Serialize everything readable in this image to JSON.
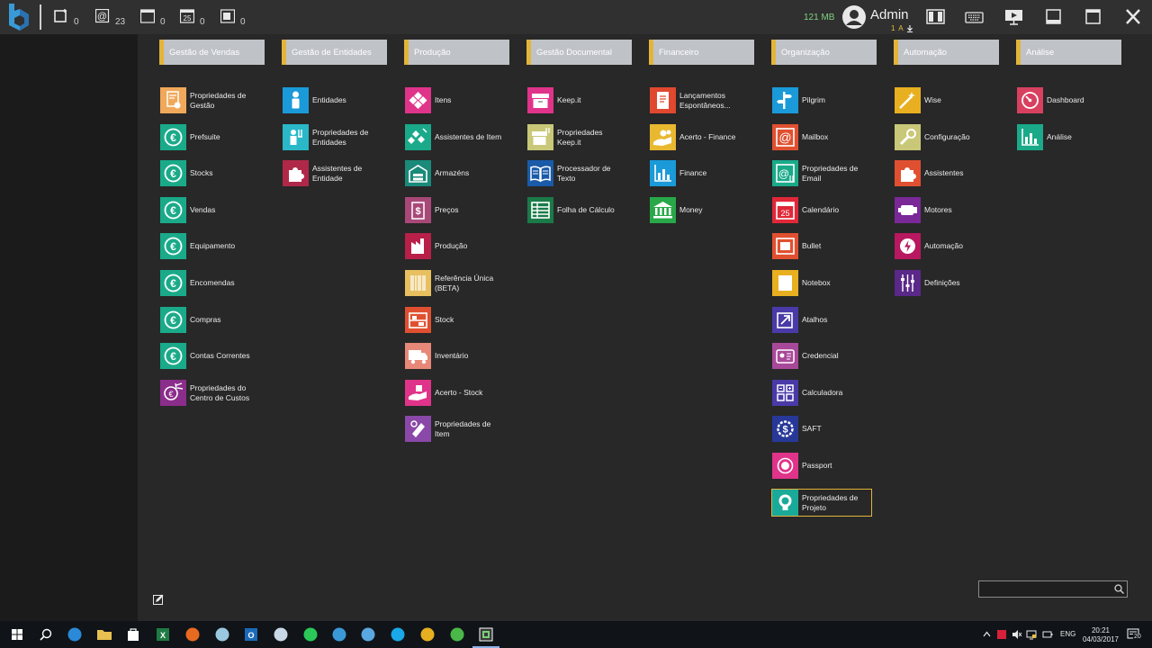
{
  "topbar": {
    "counters": [
      {
        "icon": "new-window-icon",
        "count": "0"
      },
      {
        "icon": "at-sign-icon",
        "count": "23"
      },
      {
        "icon": "window-icon",
        "count": "0"
      },
      {
        "icon": "calendar-25-icon",
        "count": "0"
      },
      {
        "icon": "notes-window-icon",
        "count": "0"
      }
    ],
    "memory": "121 MB",
    "user_name": "Admin",
    "user_sub": "1 A",
    "right_icons": [
      "layout-panels-icon",
      "keyboard-icon",
      "present-screen-icon",
      "minimize-icon",
      "maximize-icon",
      "close-icon"
    ]
  },
  "columns": [
    {
      "title": "Gestão de Vendas",
      "items": [
        {
          "label": "Propriedades de Gestão",
          "color": "#f0a85a",
          "icon": "document-settings-icon"
        },
        {
          "label": "Prefsuite",
          "color": "#1aaa8a",
          "icon": "euro-icon"
        },
        {
          "label": "Stocks",
          "color": "#1aaa8a",
          "icon": "euro-icon"
        },
        {
          "label": "Vendas",
          "color": "#1aaa8a",
          "icon": "euro-icon"
        },
        {
          "label": "Equipamento",
          "color": "#1aaa8a",
          "icon": "euro-icon"
        },
        {
          "label": "Encomendas",
          "color": "#1aaa8a",
          "icon": "euro-icon"
        },
        {
          "label": "Compras",
          "color": "#1aaa8a",
          "icon": "euro-icon"
        },
        {
          "label": "Contas Correntes",
          "color": "#1aaa8a",
          "icon": "euro-icon"
        },
        {
          "label": "Propriedades do Centro de Custos",
          "color": "#8b2d8b",
          "icon": "euro-settings-icon"
        }
      ]
    },
    {
      "title": "Gestão de Entidades",
      "items": [
        {
          "label": "Entidades",
          "color": "#1a9ad8",
          "icon": "person-icon"
        },
        {
          "label": "Propriedades de Entidades",
          "color": "#2ab8c8",
          "icon": "person-settings-icon"
        },
        {
          "label": "Assistentes de Entidade",
          "color": "#b02848",
          "icon": "puzzle-icon"
        }
      ]
    },
    {
      "title": "Produção",
      "items": [
        {
          "label": "Itens",
          "color": "#e0338a",
          "icon": "diamonds-icon"
        },
        {
          "label": "Assistentes de Item",
          "color": "#1aaa8a",
          "icon": "diamonds-wizard-icon"
        },
        {
          "label": "Armazéns",
          "color": "#1a8a7a",
          "icon": "warehouse-icon"
        },
        {
          "label": "Preços",
          "color": "#a84878",
          "icon": "price-tag-icon"
        },
        {
          "label": "Produção",
          "color": "#b8204a",
          "icon": "factory-icon"
        },
        {
          "label": "Referência Única (BETA)",
          "color": "#e8c060",
          "icon": "barcode-icon"
        },
        {
          "label": "Stock",
          "color": "#e05030",
          "icon": "shelf-icon"
        },
        {
          "label": "Inventário",
          "color": "#e88878",
          "icon": "truck-icon"
        },
        {
          "label": "Acerto - Stock",
          "color": "#e0338a",
          "icon": "hand-adjust-icon"
        },
        {
          "label": "Propriedades de Item",
          "color": "#8a48a8",
          "icon": "item-settings-icon"
        }
      ]
    },
    {
      "title": "Gestão Documental",
      "items": [
        {
          "label": "Keep.it",
          "color": "#e0338a",
          "icon": "archive-box-icon"
        },
        {
          "label": "Propriedades Keep.it",
          "color": "#c8c878",
          "icon": "archive-settings-icon"
        },
        {
          "label": "Processador de Texto",
          "color": "#1a5aa8",
          "icon": "open-book-icon"
        },
        {
          "label": "Folha de Cálculo",
          "color": "#1a7a48",
          "icon": "spreadsheet-icon"
        }
      ]
    },
    {
      "title": "Financeiro",
      "items": [
        {
          "label": "Lançamentos Espontâneos...",
          "color": "#e04830",
          "icon": "ledger-icon"
        },
        {
          "label": "Acerto - Finance",
          "color": "#e8b830",
          "icon": "hand-coins-icon"
        },
        {
          "label": "Finance",
          "color": "#1a9ad8",
          "icon": "bar-chart-icon"
        },
        {
          "label": "Money",
          "color": "#28a848",
          "icon": "bank-icon"
        }
      ]
    },
    {
      "title": "Organização",
      "items": [
        {
          "label": "Pilgrim",
          "color": "#1a9ad8",
          "icon": "signpost-icon"
        },
        {
          "label": "Mailbox",
          "color": "#e05030",
          "icon": "at-sign-icon"
        },
        {
          "label": "Propriedades de Email",
          "color": "#1aaa8a",
          "icon": "email-settings-icon"
        },
        {
          "label": "Calendário",
          "color": "#e02838",
          "icon": "calendar-25-icon"
        },
        {
          "label": "Bullet",
          "color": "#e05030",
          "icon": "bullet-icon"
        },
        {
          "label": "Notebox",
          "color": "#e8b020",
          "icon": "note-icon"
        },
        {
          "label": "Atalhos",
          "color": "#4a3aa8",
          "icon": "shortcut-icon"
        },
        {
          "label": "Credencial",
          "color": "#a84898",
          "icon": "id-card-icon"
        },
        {
          "label": "Calculadora",
          "color": "#4a3aa8",
          "icon": "calculator-icon"
        },
        {
          "label": "SAFT",
          "color": "#283898",
          "icon": "gear-dollar-icon"
        },
        {
          "label": "Passport",
          "color": "#e0338a",
          "icon": "passport-icon"
        },
        {
          "label": "Propriedades de Projeto",
          "color": "#1aaa9a",
          "icon": "lightbulb-icon",
          "selected": true
        }
      ]
    },
    {
      "title": "Automação",
      "items": [
        {
          "label": "Wise",
          "color": "#e8b020",
          "icon": "wand-icon"
        },
        {
          "label": "Configuração",
          "color": "#c8c878",
          "icon": "wrench-icon"
        },
        {
          "label": "Assistentes",
          "color": "#e05030",
          "icon": "puzzle-icon"
        },
        {
          "label": "Motores",
          "color": "#7a2898",
          "icon": "engine-icon"
        },
        {
          "label": "Automação",
          "color": "#b81860",
          "icon": "lightning-icon"
        },
        {
          "label": "Definições",
          "color": "#5a2888",
          "icon": "sliders-icon"
        }
      ]
    },
    {
      "title": "Análise",
      "items": [
        {
          "label": "Dashboard",
          "color": "#d84060",
          "icon": "gauge-icon"
        },
        {
          "label": "Análise",
          "color": "#1aaa8a",
          "icon": "bar-chart-icon"
        }
      ]
    }
  ],
  "search": {
    "placeholder": ""
  },
  "taskbar": {
    "apps": [
      "windows-start-icon",
      "search-icon",
      "edge-icon",
      "file-explorer-icon",
      "store-icon",
      "excel-icon",
      "firefox-icon",
      "notes-app-icon",
      "outlook-icon",
      "steam-icon",
      "spotify-icon",
      "app-logo-icon",
      "mail-app-icon",
      "skype-icon",
      "chrome-icon",
      "camtasia-icon",
      "app-active-icon"
    ],
    "lang": "ENG",
    "time": "20:21",
    "date": "04/03/2017",
    "notifications": "20"
  }
}
